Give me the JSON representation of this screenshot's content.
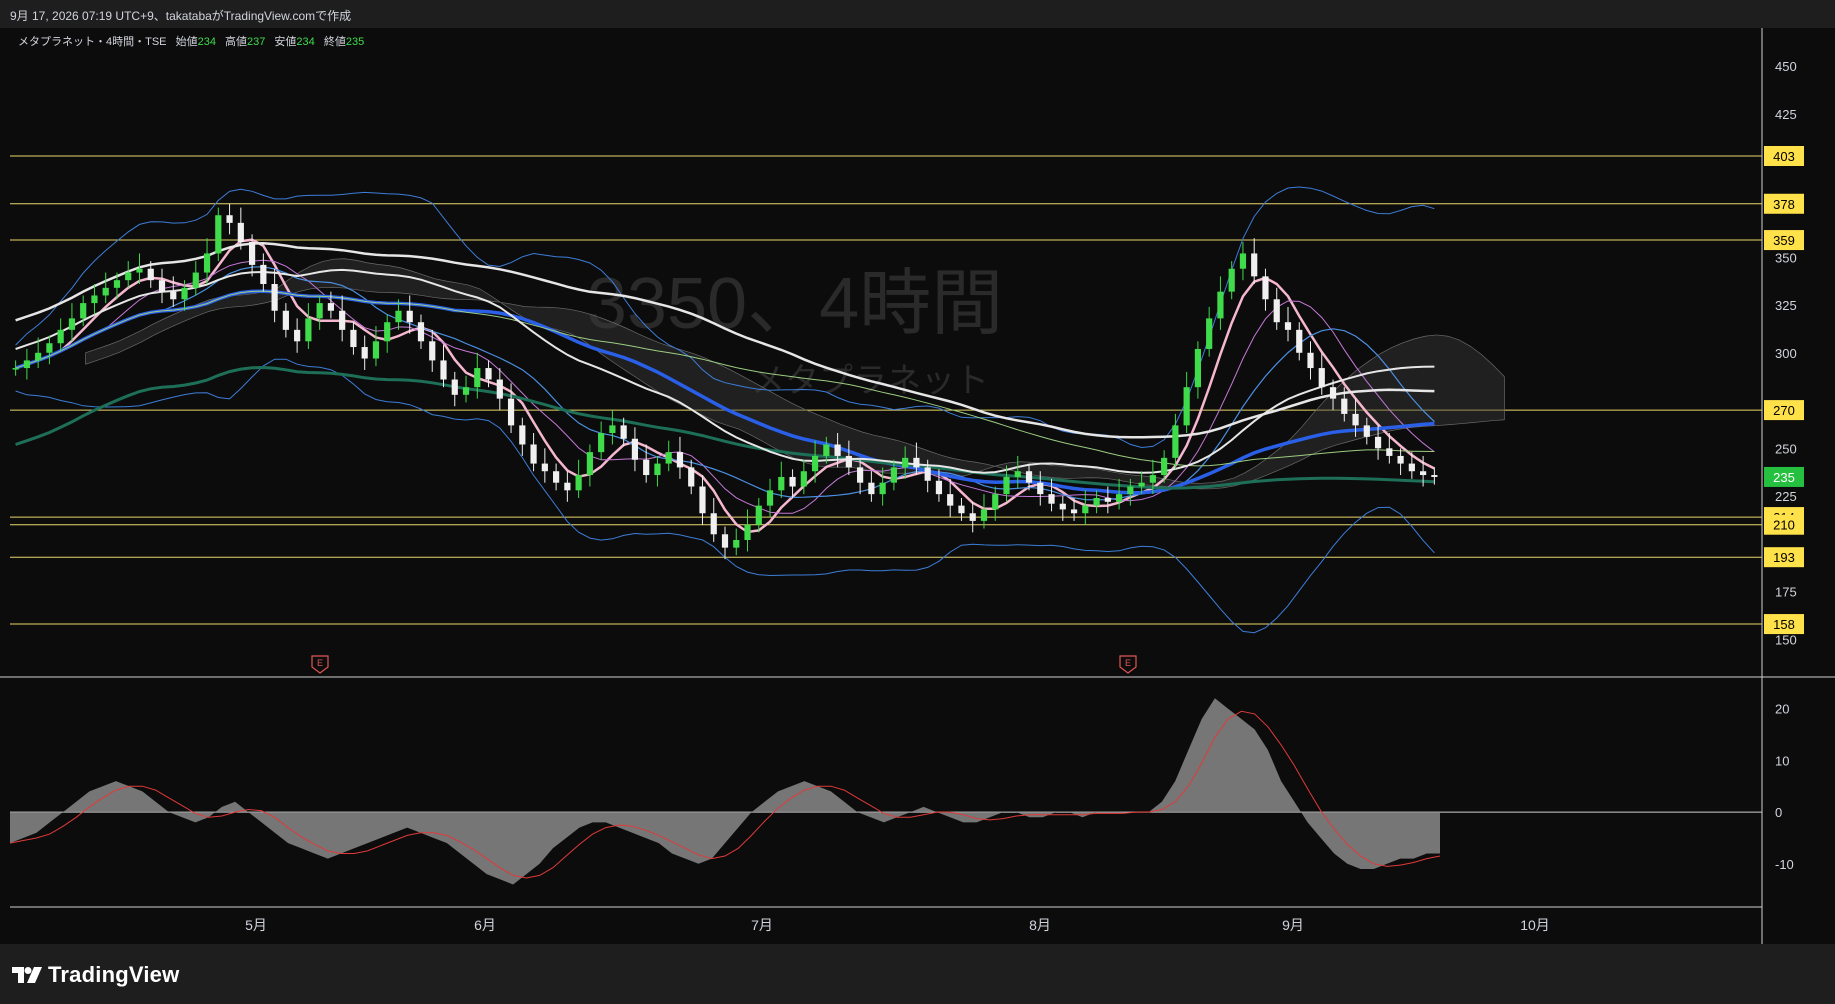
{
  "header": {
    "caption": "9月 17, 2026 07:19 UTC+9、takatabaがTradingView.comで作成"
  },
  "legend": {
    "symbol": "メタプラネット・4時間・TSE",
    "open_label": "始値",
    "open_value": "234",
    "high_label": "高値",
    "high_value": "237",
    "low_label": "安値",
    "low_value": "234",
    "close_label": "終値",
    "close_value": "235"
  },
  "watermark": {
    "code": "3350、4時間",
    "name": "メタプラネット"
  },
  "brand": {
    "name": "TradingView"
  },
  "colors": {
    "background": "#0c0c0c",
    "up": "#3fdb4a",
    "down": "#f0f0f0",
    "level": "#e8d66a",
    "level_label_bg": "#ffe14a",
    "last_price_bg": "#26c040",
    "ma_blue": "#2a5fe8",
    "ma_pink": "#f5b7cf",
    "ma_green": "#1e6f57",
    "bollinger": "#3d7dd8",
    "oscillator": "#8a8a8a"
  },
  "chart_data": [
    {
      "type": "candlestick",
      "ylim": [
        135,
        470
      ],
      "y_ticks": [
        "450",
        "425",
        "350",
        "325",
        "300",
        "250",
        "225",
        "175",
        "150"
      ],
      "x_ticks": [
        "5月",
        "6月",
        "7月",
        "8月",
        "9月",
        "10月"
      ],
      "price_levels": [
        "403",
        "378",
        "359",
        "270",
        "214",
        "210",
        "193",
        "158"
      ],
      "last_price": "235",
      "events": [
        "E",
        "E"
      ],
      "closes": [
        292,
        296,
        300,
        305,
        312,
        318,
        326,
        330,
        334,
        338,
        342,
        344,
        338,
        332,
        328,
        334,
        342,
        352,
        372,
        368,
        358,
        346,
        336,
        322,
        312,
        306,
        318,
        326,
        322,
        312,
        303,
        297,
        306,
        316,
        322,
        316,
        306,
        296,
        286,
        278,
        282,
        292,
        286,
        276,
        262,
        252,
        242,
        238,
        232,
        228,
        236,
        248,
        258,
        262,
        255,
        244,
        236,
        242,
        248,
        240,
        230,
        216,
        205,
        198,
        202,
        210,
        220,
        228,
        235,
        230,
        238,
        246,
        252,
        246,
        240,
        232,
        226,
        232,
        240,
        245,
        240,
        233,
        226,
        220,
        216,
        212,
        218,
        226,
        235,
        238,
        232,
        226,
        221,
        218,
        216,
        220,
        224,
        222,
        226,
        230,
        232,
        236,
        245,
        262,
        282,
        302,
        318,
        332,
        344,
        352,
        340,
        328,
        316,
        312,
        300,
        292,
        282,
        276,
        268,
        262,
        256,
        250,
        246,
        242,
        238,
        236,
        235
      ]
    },
    {
      "type": "area",
      "ylim": [
        -17,
        24
      ],
      "y_ticks": [
        "20",
        "10",
        "0",
        "-10"
      ],
      "values": [
        -6,
        -5,
        -4,
        -2,
        0,
        2,
        4,
        5,
        6,
        5,
        4,
        2,
        0,
        -1,
        -2,
        -1,
        1,
        2,
        0,
        -2,
        -4,
        -6,
        -7,
        -8,
        -9,
        -8,
        -7,
        -6,
        -5,
        -4,
        -3,
        -4,
        -5,
        -6,
        -8,
        -10,
        -12,
        -13,
        -14,
        -12,
        -10,
        -7,
        -5,
        -3,
        -2,
        -2,
        -3,
        -4,
        -5,
        -6,
        -8,
        -9,
        -10,
        -9,
        -6,
        -3,
        0,
        2,
        4,
        5,
        6,
        5,
        4,
        2,
        0,
        -1,
        -2,
        -1,
        0,
        1,
        0,
        -1,
        -2,
        -2,
        -1,
        0,
        0,
        -1,
        -1,
        0,
        0,
        -1,
        0,
        0,
        0,
        0,
        0,
        2,
        6,
        12,
        18,
        22,
        20,
        18,
        16,
        12,
        6,
        2,
        -2,
        -5,
        -8,
        -10,
        -11,
        -11,
        -10,
        -9,
        -9,
        -8,
        -8
      ]
    }
  ]
}
